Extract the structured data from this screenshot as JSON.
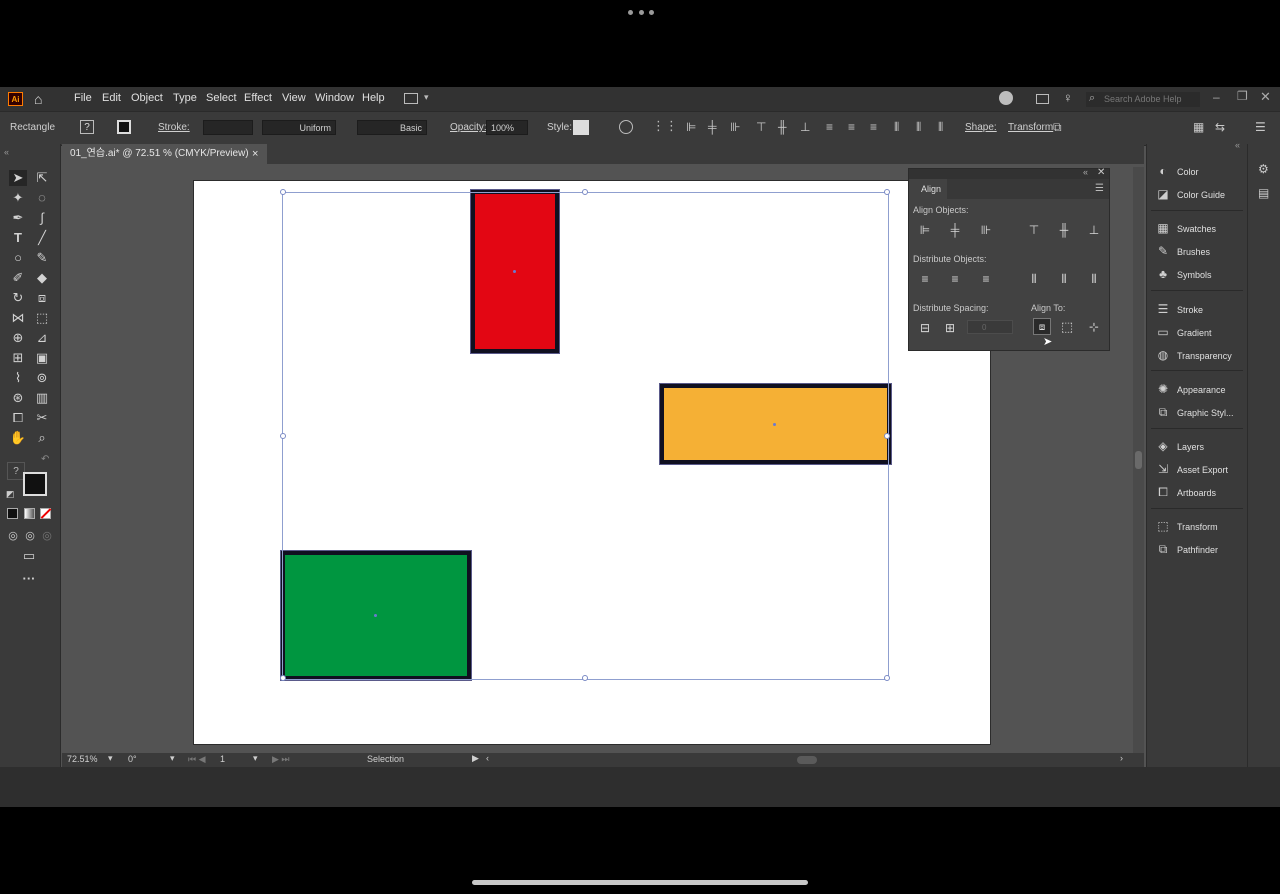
{
  "menubar": {
    "app_logo": "Ai",
    "items": [
      "File",
      "Edit",
      "Object",
      "Type",
      "Select",
      "Effect",
      "View",
      "Window",
      "Help"
    ],
    "search_placeholder": "Search Adobe Help"
  },
  "control": {
    "object_type": "Rectangle",
    "stroke_label": "Stroke:",
    "stroke_profile": "Uniform",
    "brush": "Basic",
    "opacity_label": "Opacity:",
    "opacity_value": "100%",
    "style_label": "Style:",
    "shape_label": "Shape:",
    "transform_label": "Transform"
  },
  "document": {
    "tab_title": "01_연습.ai* @ 72.51 % (CMYK/Preview)",
    "close": "×"
  },
  "canvas": {
    "shapes": [
      {
        "name": "red-rectangle",
        "color": "#e30613"
      },
      {
        "name": "orange-rectangle",
        "color": "#f5b035"
      },
      {
        "name": "green-rectangle",
        "color": "#009640"
      }
    ]
  },
  "align_panel": {
    "title": "Align",
    "align_objects": "Align Objects:",
    "distribute_objects": "Distribute Objects:",
    "distribute_spacing": "Distribute Spacing:",
    "align_to": "Align To:",
    "spacing_value": "0"
  },
  "dock": {
    "items": [
      "Color",
      "Color Guide",
      "Swatches",
      "Brushes",
      "Symbols",
      "Stroke",
      "Gradient",
      "Transparency",
      "Appearance",
      "Graphic Styl...",
      "Layers",
      "Asset Export",
      "Artboards",
      "Transform",
      "Pathfinder"
    ]
  },
  "status": {
    "zoom": "72.51%",
    "rotation": "0°",
    "artboard_number": "1",
    "tool": "Selection"
  }
}
